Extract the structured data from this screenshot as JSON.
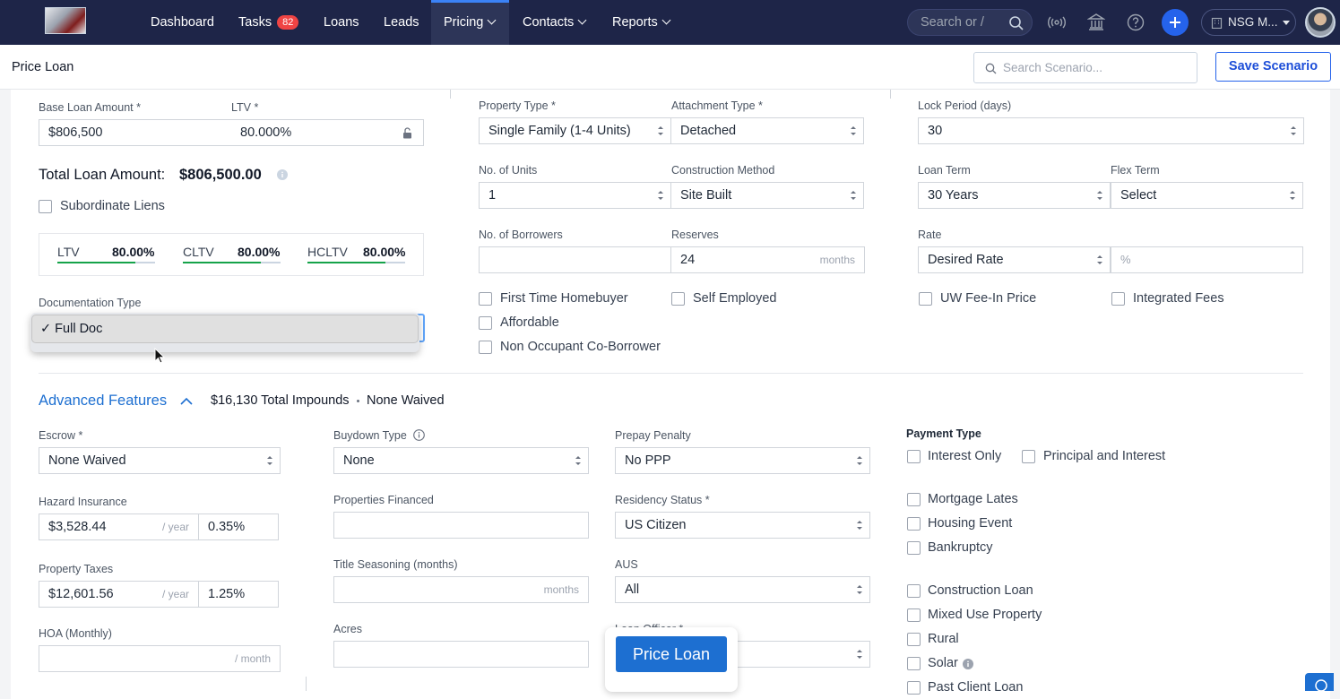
{
  "nav": {
    "items": [
      {
        "label": "Dashboard"
      },
      {
        "label": "Tasks",
        "badge": "82"
      },
      {
        "label": "Loans"
      },
      {
        "label": "Leads"
      },
      {
        "label": "Pricing",
        "active": true
      },
      {
        "label": "Contacts"
      },
      {
        "label": "Reports"
      }
    ],
    "search_placeholder": "Search or /",
    "org_label": "NSG M...",
    "colors": {
      "bar": "#1e2548",
      "badge": "#ef4444",
      "accent": "#2563eb"
    }
  },
  "page": {
    "title": "Price Loan",
    "search_scenario_placeholder": "Search Scenario...",
    "save_label": "Save Scenario"
  },
  "loan": {
    "base_amount_label": "Base Loan Amount *",
    "base_amount": "$806,500",
    "ltv_label": "LTV *",
    "ltv": "80.000%",
    "total_label": "Total Loan Amount:",
    "total_value": "$806,500.00",
    "subordinate_label": "Subordinate Liens",
    "ratios": [
      {
        "label": "LTV",
        "value": "80.00%",
        "fill": 0.8
      },
      {
        "label": "CLTV",
        "value": "80.00%",
        "fill": 0.8
      },
      {
        "label": "HCLTV",
        "value": "80.00%",
        "fill": 0.8
      }
    ],
    "doc_type_label": "Documentation Type",
    "doc_type_option": "✓ Full Doc"
  },
  "property": {
    "property_type_label": "Property Type *",
    "property_type": "Single Family (1-4 Units)",
    "attachment_label": "Attachment Type *",
    "attachment": "Detached",
    "units_label": "No. of Units",
    "units": "1",
    "construction_label": "Construction Method",
    "construction": "Site Built",
    "borrowers_label": "No. of Borrowers",
    "borrowers": "",
    "reserves_label": "Reserves",
    "reserves": "24",
    "reserves_suffix": "months",
    "checks": [
      "First Time Homebuyer",
      "Self Employed",
      "Affordable",
      "Non Occupant Co-Borrower"
    ]
  },
  "terms": {
    "lock_label": "Lock Period (days)",
    "lock": "30",
    "term_label": "Loan Term",
    "term": "30 Years",
    "flex_label": "Flex Term",
    "flex": "Select",
    "rate_label": "Rate",
    "rate_mode": "Desired Rate",
    "rate_placeholder": "%",
    "checks": [
      "UW Fee-In Price",
      "Integrated Fees"
    ]
  },
  "advanced": {
    "title": "Advanced Features",
    "impounds": "$16,130 Total Impounds",
    "waived": "None Waived",
    "escrow_label": "Escrow *",
    "escrow": "None Waived",
    "hazard_label": "Hazard Insurance",
    "hazard_amount": "$3,528.44",
    "hazard_pct": "0.35%",
    "tax_label": "Property Taxes",
    "tax_amount": "$12,601.56",
    "tax_pct": "1.25%",
    "year_suffix": "/ year",
    "hoa_label": "HOA (Monthly)",
    "hoa_suffix": "/ month",
    "buydown_label": "Buydown Type",
    "buydown": "None",
    "financed_label": "Properties Financed",
    "seasoning_label": "Title Seasoning (months)",
    "seasoning_suffix": "months",
    "acres_label": "Acres",
    "prepay_label": "Prepay Penalty",
    "prepay": "No PPP",
    "residency_label": "Residency Status *",
    "residency": "US Citizen",
    "aus_label": "AUS",
    "aus": "All",
    "officer_label": "Loan Officer *",
    "payment_label": "Payment Type",
    "payment_options": [
      "Interest Only",
      "Principal and Interest"
    ],
    "credit_checks": [
      "Mortgage Lates",
      "Housing Event",
      "Bankruptcy"
    ],
    "property_checks": [
      "Construction Loan",
      "Mixed Use Property",
      "Rural",
      "Solar",
      "Past Client Loan"
    ]
  },
  "price_button": "Price Loan"
}
